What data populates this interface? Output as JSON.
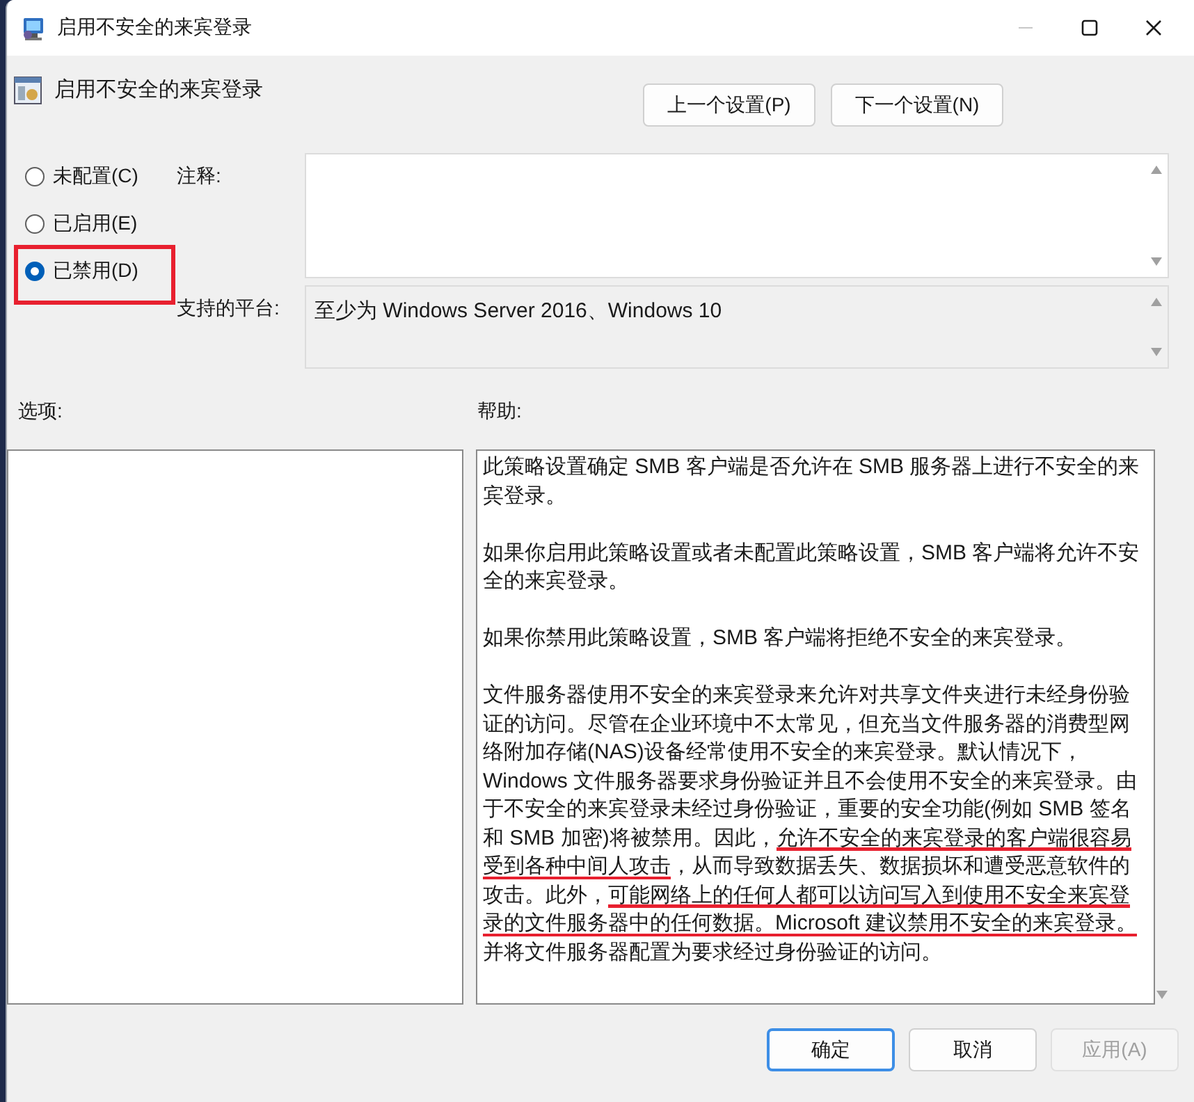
{
  "window": {
    "title": "启用不安全的来宾登录"
  },
  "header": {
    "title": "启用不安全的来宾登录",
    "buttons": [
      "上一个设置(P)",
      "下一个设置(N)"
    ]
  },
  "radios": [
    {
      "label": "未配置(C)",
      "selected": false,
      "annotated": false
    },
    {
      "label": "已启用(E)",
      "selected": false,
      "annotated": false
    },
    {
      "label": "已禁用(D)",
      "selected": true,
      "annotated": true
    }
  ],
  "comment": {
    "label": "注释:"
  },
  "platform": {
    "label": "支持的平台:",
    "value": "至少为 Windows Server 2016、Windows 10"
  },
  "options": {
    "label": "选项:"
  },
  "help": {
    "label": "帮助:",
    "paragraphs": [
      [
        {
          "text": "此策略设置确定 SMB 客户端是否允许在 SMB 服务器上进行不安全的来宾登录。",
          "underlined": false
        }
      ],
      [
        {
          "text": "如果你启用此策略设置或者未配置此策略设置，SMB 客户端将允许不安全的来宾登录。",
          "underlined": false
        }
      ],
      [
        {
          "text": "如果你禁用此策略设置，SMB 客户端将拒绝不安全的来宾登录。",
          "underlined": false
        }
      ],
      [
        {
          "text": "文件服务器使用不安全的来宾登录来允许对共享文件夹进行未经身份验证的访问。尽管在企业环境中不太常见，但充当文件服务器的消费型网络附加存储(NAS)设备经常使用不安全的来宾登录。默认情况下，Windows 文件服务器要求身份验证并且不会使用不安全的来宾登录。由于不安全的来宾登录未经过身份验证，重要的安全功能(例如 SMB 签名和 SMB 加密)将被禁用。因此，",
          "underlined": false
        },
        {
          "text": "允许不安全的来宾登录的客户端很容易受到各种中间人攻击",
          "underlined": true
        },
        {
          "text": "，从而导致数据丢失、数据损坏和遭受恶意软件的攻击。此外，",
          "underlined": false
        },
        {
          "text": "可能网络上的任何人都可以访问写入到使用不安全来宾登录的文件服务器中的任何数据。Microsoft 建议禁用不安全的来宾登录。",
          "underlined": true
        },
        {
          "text": "并将文件服务器配置为要求经过身份验证的访问。",
          "underlined": false
        }
      ]
    ]
  },
  "footer": {
    "buttons": [
      {
        "label": "确定",
        "kind": "default",
        "disabled": false
      },
      {
        "label": "取消",
        "kind": "normal",
        "disabled": false
      },
      {
        "label": "应用(A)",
        "kind": "normal",
        "disabled": true
      }
    ]
  }
}
